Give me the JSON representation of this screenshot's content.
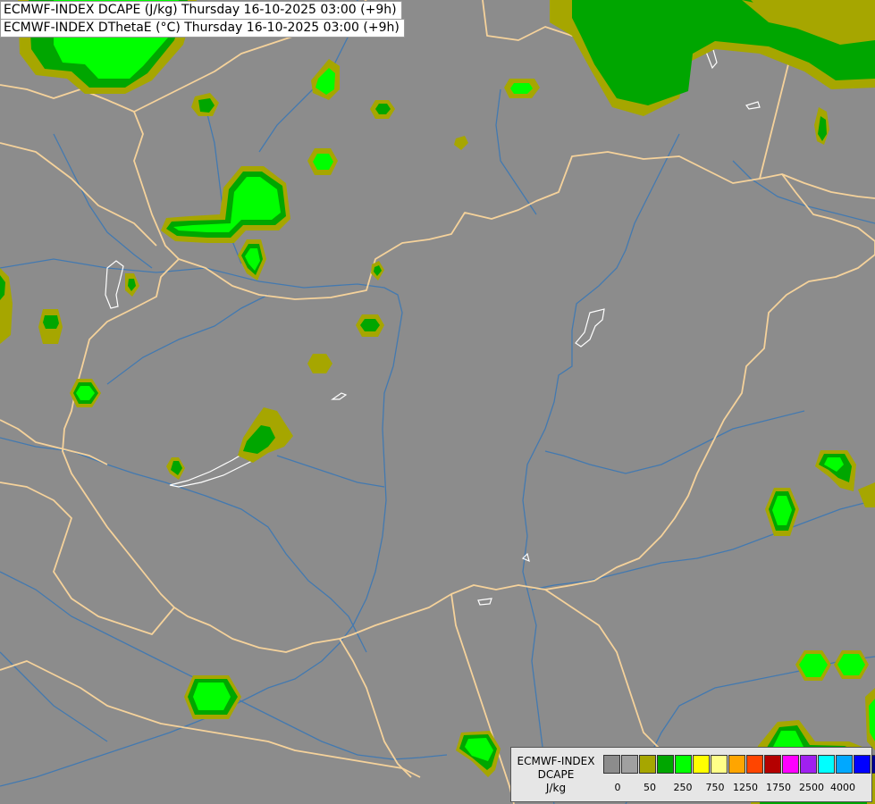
{
  "titles": {
    "line1": "ECMWF-INDEX DCAPE (J/kg) Thursday 16-10-2025 03:00 (+9h)",
    "line2": "ECMWF-INDEX DThetaE (°C) Thursday 16-10-2025 03:00 (+9h)"
  },
  "legend": {
    "title_line1": "ECMWF-INDEX",
    "title_line2": "DCAPE",
    "unit": "J/kg",
    "colors": [
      "#8c8c8c",
      "#a0a0a0",
      "#a6a600",
      "#00a600",
      "#00ff00",
      "#ffff00",
      "#ffff88",
      "#ffa500",
      "#ff4500",
      "#b40000",
      "#ff00ff",
      "#a020f0",
      "#00ffff",
      "#00a8ff",
      "#0000ff",
      "#000090"
    ],
    "ticks": [
      "0",
      "50",
      "250",
      "750",
      "1250",
      "1750",
      "2500",
      "4000"
    ]
  },
  "map_colors": {
    "background": "#8c8c8c",
    "border": "#f5d29b",
    "river": "#3c78b4",
    "lake": "#ffffff",
    "low": "#a6a600",
    "mid": "#00a600",
    "high": "#00ff00"
  }
}
